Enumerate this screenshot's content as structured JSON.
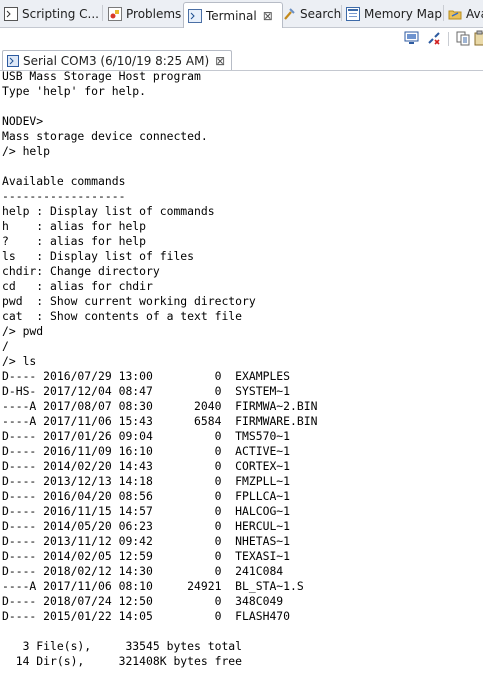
{
  "tabs": [
    {
      "label": "Scripting C...",
      "icon": "scripting-console-icon"
    },
    {
      "label": "Problems",
      "icon": "problems-icon"
    },
    {
      "label": "Terminal",
      "icon": "terminal-icon",
      "active": true,
      "close": "⊠"
    },
    {
      "label": "Search",
      "icon": "search-icon"
    },
    {
      "label": "Memory Map",
      "icon": "memory-map-icon"
    },
    {
      "label": "Ava",
      "icon": "folder-icon"
    }
  ],
  "session_tab": {
    "label": "Serial COM3 (6/10/19 8:25 AM)",
    "close": "⊠"
  },
  "terminal_lines": [
    "USB Mass Storage Host program",
    "Type 'help' for help.",
    "",
    "NODEV>",
    "Mass storage device connected.",
    "/> help",
    "",
    "Available commands",
    "------------------",
    "help : Display list of commands",
    "h    : alias for help",
    "?    : alias for help",
    "ls   : Display list of files",
    "chdir: Change directory",
    "cd   : alias for chdir",
    "pwd  : Show current working directory",
    "cat  : Show contents of a text file",
    "/> pwd",
    "/",
    "/> ls",
    "D---- 2016/07/29 13:00         0  EXAMPLES",
    "D-HS- 2017/12/04 08:47         0  SYSTEM~1",
    "----A 2017/08/07 08:30      2040  FIRMWA~2.BIN",
    "----A 2017/11/06 15:43      6584  FIRMWARE.BIN",
    "D---- 2017/01/26 09:04         0  TMS570~1",
    "D---- 2016/11/09 16:10         0  ACTIVE~1",
    "D---- 2014/02/20 14:43         0  CORTEX~1",
    "D---- 2013/12/13 14:18         0  FMZPLL~1",
    "D---- 2016/04/20 08:56         0  FPLLCA~1",
    "D---- 2016/11/15 14:57         0  HALCOG~1",
    "D---- 2014/05/20 06:23         0  HERCUL~1",
    "D---- 2013/11/12 09:42         0  NHETAS~1",
    "D---- 2014/02/05 12:59         0  TEXASI~1",
    "D---- 2018/02/12 14:30         0  241C084",
    "----A 2017/11/06 08:10     24921  BL_STA~1.S",
    "D---- 2018/07/24 12:50         0  348C049",
    "D---- 2015/01/22 14:05         0  FLASH470",
    "",
    "   3 File(s),     33545 bytes total",
    "  14 Dir(s),     321408K bytes free"
  ]
}
